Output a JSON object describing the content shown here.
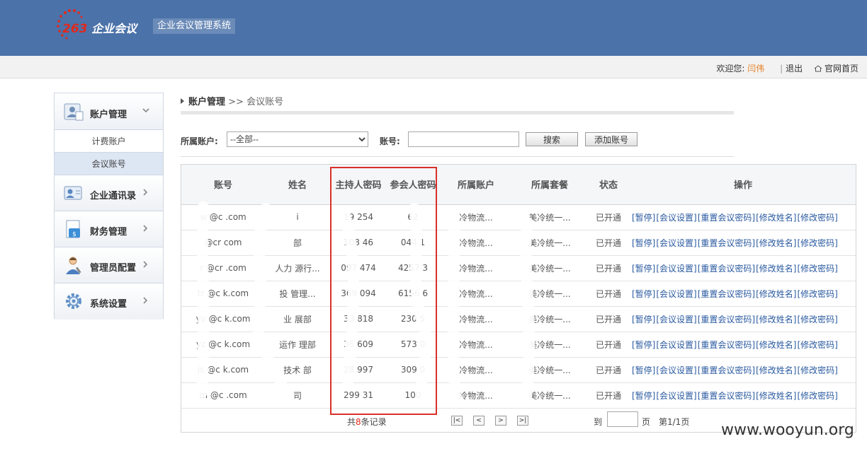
{
  "header": {
    "logo_num": "263",
    "logo_brand": "企业会议",
    "system_name": "企业会议管理系统"
  },
  "userbar": {
    "welcome": "欢迎您:",
    "username": "闫伟",
    "logout": "退出",
    "home": "官网首页"
  },
  "sidebar": {
    "group_title": "账户管理",
    "subitems": [
      {
        "label": "计费账户",
        "active": false
      },
      {
        "label": "会议账号",
        "active": true
      }
    ],
    "items": [
      {
        "label": "企业通讯录",
        "icon": "contacts-icon"
      },
      {
        "label": "财务管理",
        "icon": "finance-icon"
      },
      {
        "label": "管理员配置",
        "icon": "admin-icon"
      },
      {
        "label": "系统设置",
        "icon": "settings-gear-icon"
      }
    ]
  },
  "breadcrumb": {
    "parent": "账户管理",
    "separator": ">>",
    "current": "会议账号"
  },
  "search": {
    "account_label": "所属账户:",
    "account_selected": "--全部--",
    "number_label": "账号:",
    "number_value": "",
    "search_button": "搜索",
    "add_button": "添加账号"
  },
  "table": {
    "columns": [
      "账号",
      "姓名",
      "主持人密码",
      "参会人密码",
      "所属账户",
      "所属套餐",
      "状态",
      "操作"
    ],
    "rows": [
      [
        "w   @c    .com",
        "i  ",
        "19   254",
        "62    ",
        "    冷物流...",
        "    美冷统一...",
        "已开通"
      ],
      [
        "   @cr    com",
        "   部",
        "108   46",
        "044   1",
        "    冷物流...",
        "    美冷统一...",
        "已开通"
      ],
      [
        "r   @cr   .com",
        "人力    源行...",
        "097   474",
        "4257   3",
        "    冷物流...",
        "    美冷统一...",
        "已开通"
      ],
      [
        "tr   @c    k.com",
        "投    管理...",
        "369   094",
        "6156   6",
        "    冷物流...",
        "    美冷统一...",
        "已开通"
      ],
      [
        "yv   @c    k.com",
        "业    展部",
        "33    818",
        "230    5",
        "    冷物流...",
        "    美冷统一...",
        "已开通"
      ],
      [
        "yz   @c    k.com",
        "运作    理部",
        "36    609",
        "573    0",
        "    冷物流...",
        "    美冷统一...",
        "已开通"
      ],
      [
        "js   @c    k.com",
        "技术    部",
        "28   997",
        "309    0",
        "    冷物流...",
        "    美冷统一...",
        "已开通"
      ],
      [
        "m   @c    .com",
        "    司",
        "299    31",
        "100    ",
        "    冷物流...",
        "    美冷统一...",
        "已开通"
      ]
    ],
    "ops": [
      "[暂停]",
      "[会议设置]",
      "[重置会议密码]",
      "[修改姓名]",
      "[修改密码]"
    ]
  },
  "pager": {
    "total_prefix": "共",
    "total_count": "8",
    "total_suffix": "条记录",
    "first": "|<",
    "prev": "<",
    "next": ">",
    "last": ">|",
    "goto_label": "到",
    "page_unit": "页",
    "page_info": "第1/1页"
  },
  "watermark": "www.wooyun.org",
  "colors": {
    "header_bg": "#4b72a9",
    "link": "#2a5aa0",
    "highlight_box": "#d9302a",
    "username": "#e67e22"
  }
}
